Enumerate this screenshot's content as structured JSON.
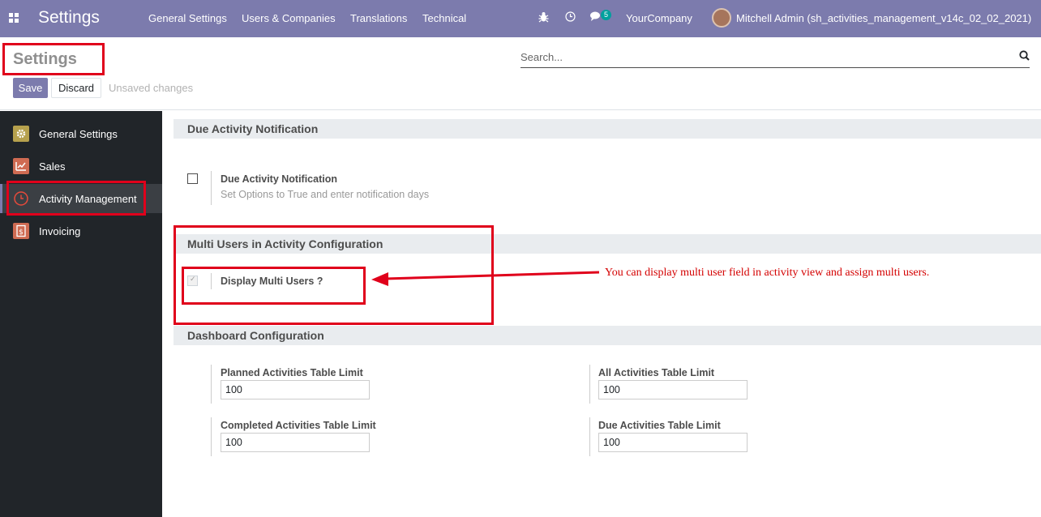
{
  "navbar": {
    "brand": "Settings",
    "menus": [
      "General Settings",
      "Users & Companies",
      "Translations",
      "Technical"
    ],
    "message_count": "5",
    "company": "YourCompany",
    "user": "Mitchell Admin (sh_activities_management_v14c_02_02_2021)",
    "bg_color": "#7c7bad"
  },
  "control": {
    "title": "Settings",
    "search_placeholder": "Search...",
    "save_label": "Save",
    "discard_label": "Discard",
    "status": "Unsaved changes"
  },
  "sidebar": {
    "items": [
      {
        "label": "General Settings",
        "icon": "gear-icon"
      },
      {
        "label": "Sales",
        "icon": "chart-icon"
      },
      {
        "label": "Activity Management",
        "icon": "clock-icon"
      },
      {
        "label": "Invoicing",
        "icon": "invoice-icon"
      }
    ]
  },
  "sections": {
    "due": {
      "heading": "Due Activity Notification",
      "setting_title": "Due Activity Notification",
      "setting_help": "Set Options to True and enter notification days",
      "checked": false
    },
    "multi": {
      "heading": "Multi Users in Activity Configuration",
      "setting_title": "Display Multi Users ?",
      "checked": true
    },
    "dashboard": {
      "heading": "Dashboard Configuration",
      "fields": [
        {
          "label": "Planned Activities Table Limit",
          "value": "100"
        },
        {
          "label": "All Activities Table Limit",
          "value": "100"
        },
        {
          "label": "Completed Activities Table Limit",
          "value": "100"
        },
        {
          "label": "Due Activities Table Limit",
          "value": "100"
        }
      ]
    }
  },
  "annotation": {
    "text": "You can display multi user field in activity view and assign multi users.",
    "color": "#e0001b"
  }
}
